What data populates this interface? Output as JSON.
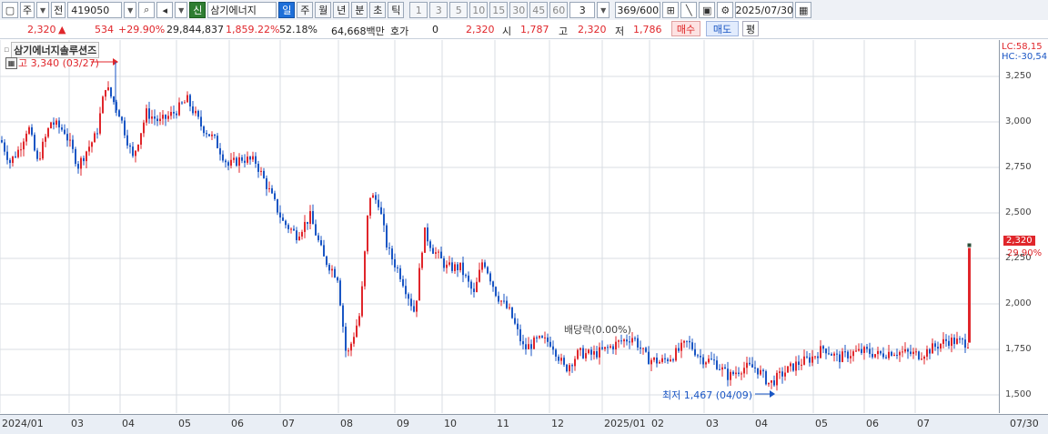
{
  "toolbar": {
    "mode_label": "주",
    "prev_label": "전",
    "stock_code": "419050",
    "credit_badge": "신",
    "stock_name": "삼기에너지",
    "periods": [
      "일",
      "주",
      "월",
      "년",
      "분",
      "초",
      "틱"
    ],
    "selected_period": "일",
    "intervals": [
      "1",
      "3",
      "5",
      "10",
      "15",
      "30",
      "45",
      "60"
    ],
    "interval_value": "3",
    "bar_count": "369/600",
    "date": "2025/07/30"
  },
  "info": {
    "price": "2,320",
    "change": "534",
    "change_pct": "+29.90%",
    "volume": "29,844,837",
    "volume_ratio": "1,859.22%",
    "turnover": "52.18%",
    "trade_value": "64,668백만",
    "quote_label": "호가",
    "quote_value": "0",
    "quote_price": "2,320",
    "open_label": "시",
    "open": "1,787",
    "high_label": "고",
    "high": "2,320",
    "low_label": "저",
    "low": "1,786",
    "buy_label": "매수",
    "sell_label": "매도",
    "avg_label": "평"
  },
  "chart_header": {
    "name": "삼기에너지솔루션즈",
    "high_marker": "고 3,340 (03/27)",
    "low_marker": "최저 1,467 (04/09)",
    "event_marker": "배당락(0.00%)",
    "lc_label": "LC:58,15",
    "hc_label": "HC:-30,54",
    "last_price_tag": "2,320",
    "last_change_tag": "29.90%"
  },
  "colors": {
    "up": "#e0262b",
    "down": "#1a56c4",
    "grid": "#d9dde3",
    "highlight": "#e0262b"
  },
  "chart_data": {
    "type": "candlestick",
    "y_ticks": [
      "3,250",
      "3,000",
      "2,750",
      "2,500",
      "2,250",
      "2,000",
      "1,750",
      "1,500"
    ],
    "ylim": [
      1400,
      3450
    ],
    "x_ticks": [
      "2024/01",
      "03",
      "04",
      "05",
      "06",
      "07",
      "08",
      "09",
      "10",
      "11",
      "12",
      "2025/01",
      "02",
      "03",
      "04",
      "05",
      "06",
      "07",
      "07/30"
    ],
    "close_path": [
      [
        0,
        2900
      ],
      [
        10,
        2780
      ],
      [
        20,
        2850
      ],
      [
        30,
        2980
      ],
      [
        40,
        2780
      ],
      [
        55,
        3000
      ],
      [
        70,
        2950
      ],
      [
        85,
        2760
      ],
      [
        95,
        2850
      ],
      [
        105,
        2930
      ],
      [
        115,
        3200
      ],
      [
        130,
        3050
      ],
      [
        145,
        2800
      ],
      [
        160,
        3050
      ],
      [
        175,
        3000
      ],
      [
        190,
        3050
      ],
      [
        205,
        3120
      ],
      [
        220,
        2980
      ],
      [
        235,
        2900
      ],
      [
        250,
        2760
      ],
      [
        265,
        2800
      ],
      [
        280,
        2780
      ],
      [
        295,
        2620
      ],
      [
        310,
        2450
      ],
      [
        325,
        2380
      ],
      [
        340,
        2480
      ],
      [
        355,
        2250
      ],
      [
        370,
        2150
      ],
      [
        380,
        1700
      ],
      [
        395,
        1950
      ],
      [
        405,
        2600
      ],
      [
        415,
        2560
      ],
      [
        425,
        2300
      ],
      [
        440,
        2150
      ],
      [
        455,
        1950
      ],
      [
        465,
        2400
      ],
      [
        475,
        2300
      ],
      [
        490,
        2200
      ],
      [
        505,
        2200
      ],
      [
        520,
        2050
      ],
      [
        530,
        2250
      ],
      [
        545,
        2050
      ],
      [
        560,
        1950
      ],
      [
        575,
        1750
      ],
      [
        590,
        1800
      ],
      [
        605,
        1790
      ],
      [
        620,
        1640
      ],
      [
        635,
        1730
      ],
      [
        650,
        1720
      ],
      [
        665,
        1750
      ],
      [
        680,
        1790
      ],
      [
        695,
        1820
      ],
      [
        710,
        1700
      ],
      [
        725,
        1680
      ],
      [
        740,
        1720
      ],
      [
        755,
        1790
      ],
      [
        770,
        1700
      ],
      [
        785,
        1680
      ],
      [
        800,
        1600
      ],
      [
        815,
        1650
      ],
      [
        830,
        1650
      ],
      [
        845,
        1560
      ],
      [
        860,
        1620
      ],
      [
        875,
        1670
      ],
      [
        890,
        1700
      ],
      [
        905,
        1760
      ],
      [
        920,
        1700
      ],
      [
        935,
        1730
      ],
      [
        950,
        1740
      ],
      [
        965,
        1720
      ],
      [
        980,
        1740
      ],
      [
        995,
        1730
      ],
      [
        1010,
        1720
      ],
      [
        1025,
        1760
      ],
      [
        1040,
        1800
      ],
      [
        1055,
        1790
      ],
      [
        1066,
        1787
      ]
    ],
    "last_open": 1787,
    "last_close": 2320
  }
}
